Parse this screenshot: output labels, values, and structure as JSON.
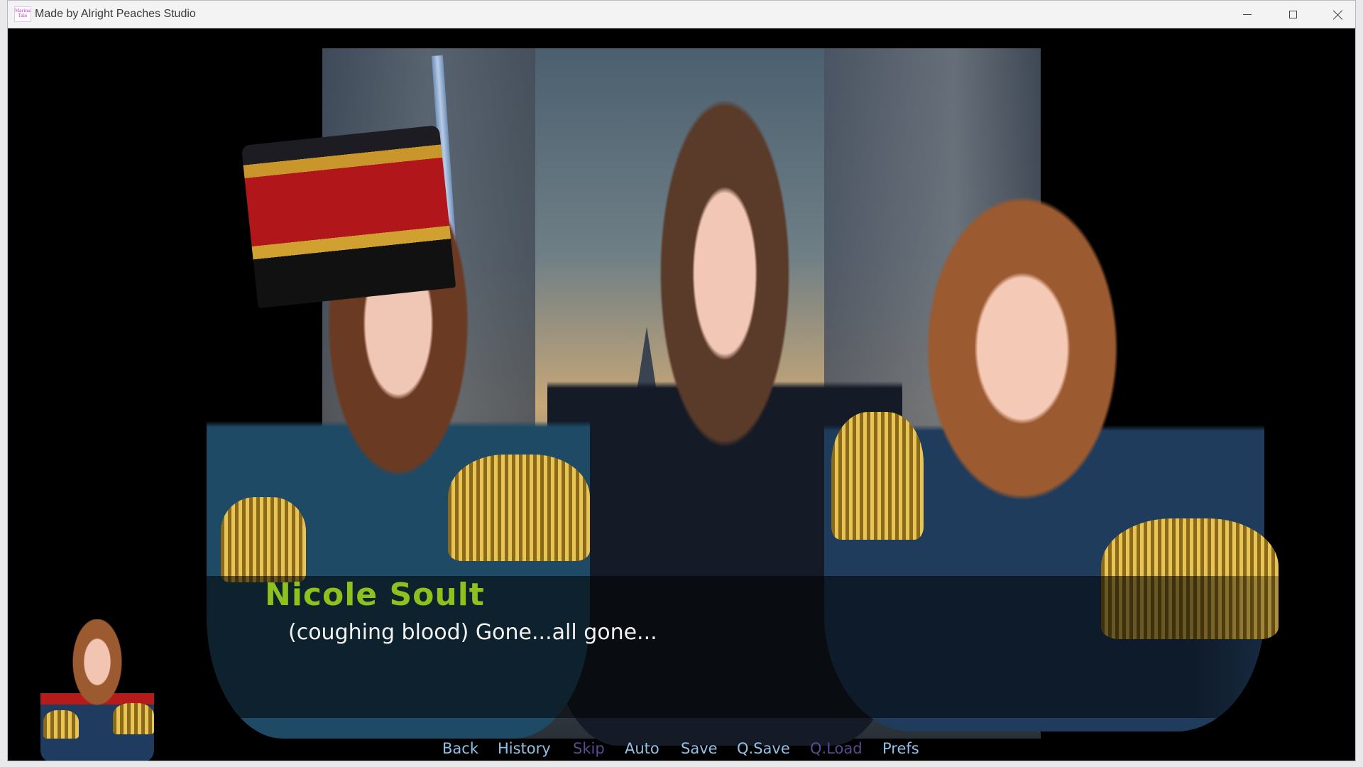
{
  "window": {
    "title": "Made by Alright Peaches Studio",
    "icon_text": "Marina Tale",
    "controls": [
      "minimize",
      "maximize",
      "close"
    ]
  },
  "dialogue": {
    "speaker": "Nicole Soult",
    "speaker_color": "#8dc21e",
    "text": "(coughing blood) Gone...all gone..."
  },
  "quick_menu": {
    "items": [
      {
        "label": "Back",
        "enabled": true
      },
      {
        "label": "History",
        "enabled": true
      },
      {
        "label": "Skip",
        "enabled": false
      },
      {
        "label": "Auto",
        "enabled": true
      },
      {
        "label": "Save",
        "enabled": true
      },
      {
        "label": "Q.Save",
        "enabled": true
      },
      {
        "label": "Q.Load",
        "enabled": false
      },
      {
        "label": "Prefs",
        "enabled": true
      }
    ],
    "enabled_color": "#8fc2e8",
    "disabled_color": "#5b4b8c"
  }
}
